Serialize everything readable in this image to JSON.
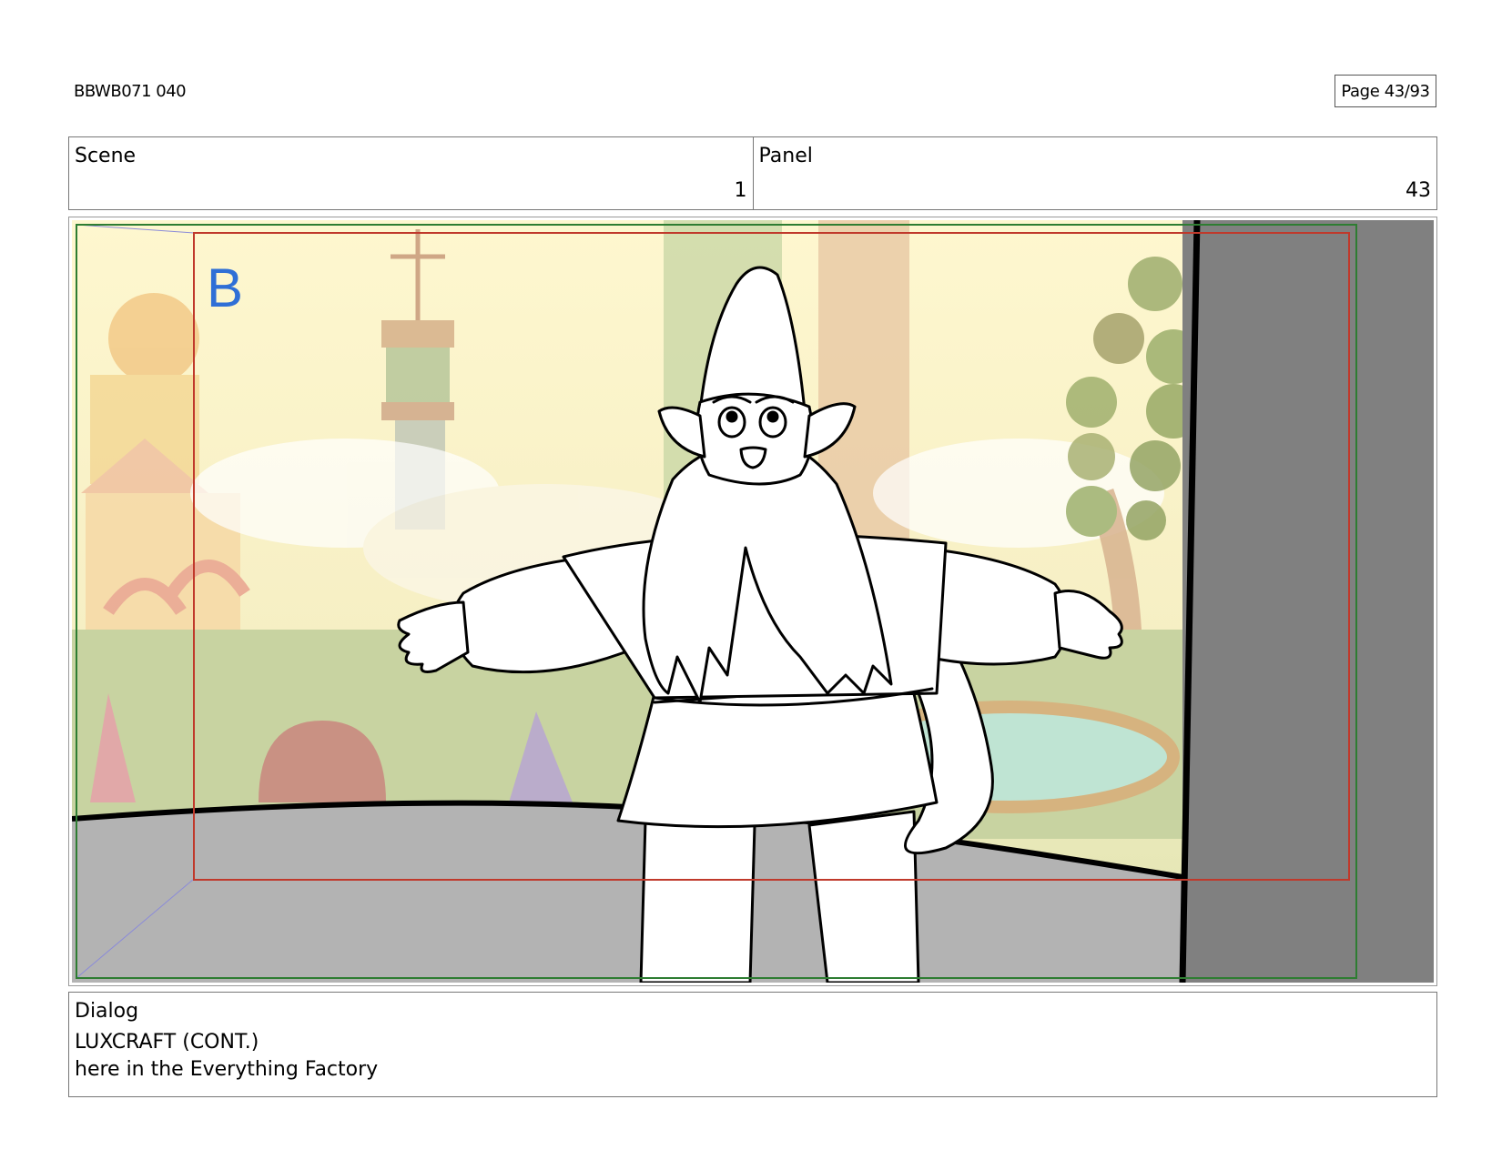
{
  "header": {
    "doc_id": "BBWB071 040",
    "page": "Page 43/93"
  },
  "info": {
    "scene_label": "Scene",
    "scene_value": "1",
    "panel_label": "Panel",
    "panel_value": "43"
  },
  "panel": {
    "layer_marker": "B",
    "colors": {
      "sky": "#fdf3c2",
      "ground": "#b3b3b3",
      "wall": "#808080",
      "safe_frame": "#c0392b",
      "camera_frame": "#2e7d32",
      "marker": "#2f6fd6"
    }
  },
  "dialog": {
    "label": "Dialog",
    "speaker": "LUXCRAFT (CONT.)",
    "line": "here in the Everything Factory"
  }
}
